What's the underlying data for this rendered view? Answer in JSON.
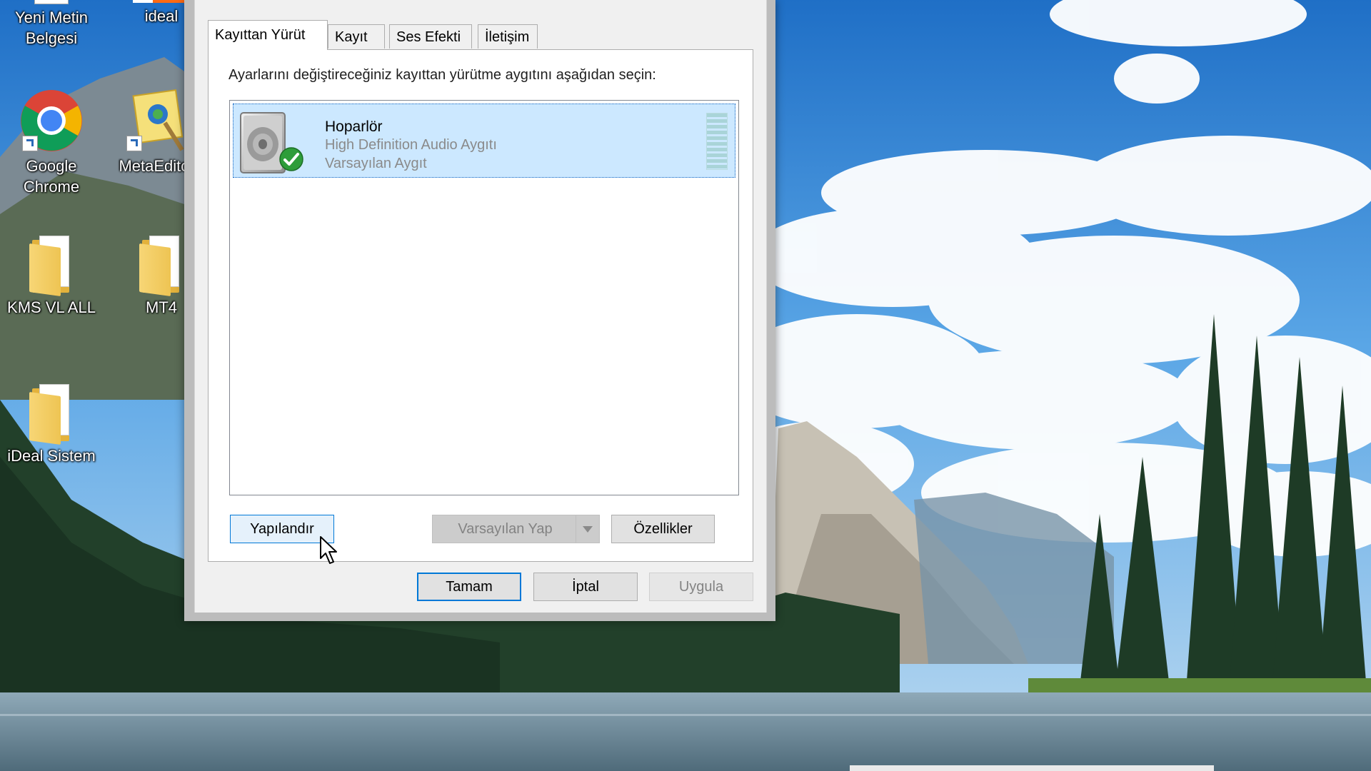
{
  "desktop": {
    "icons": [
      {
        "id": "yeni-metin",
        "label": "Yeni Metin Belgesi"
      },
      {
        "id": "ideal",
        "label": "ideal"
      },
      {
        "id": "google-chrome",
        "label": "Google Chrome"
      },
      {
        "id": "metaeditor",
        "label": "MetaEdito"
      },
      {
        "id": "kms",
        "label": "KMS VL ALL"
      },
      {
        "id": "mt4",
        "label": "MT4"
      },
      {
        "id": "ideal-sistem",
        "label": "iDeal Sistem"
      }
    ]
  },
  "dialog": {
    "tabs": [
      {
        "label": "Kayıttan Yürüt",
        "active": true
      },
      {
        "label": "Kayıt",
        "active": false
      },
      {
        "label": "Ses Efekti",
        "active": false
      },
      {
        "label": "İletişim",
        "active": false
      }
    ],
    "instruction": "Ayarlarını değiştireceğiniz kayıttan yürütme aygıtını aşağıdan seçin:",
    "devices": [
      {
        "name": "Hoparlör",
        "description": "High Definition Audio Aygıtı",
        "status": "Varsayılan Aygıt",
        "icon": "speaker-icon",
        "badge": "default-check-icon",
        "selected": true
      }
    ],
    "buttons": {
      "configure": "Yapılandır",
      "set_default": "Varsayılan Yap",
      "properties": "Özellikler",
      "ok": "Tamam",
      "cancel": "İptal",
      "apply": "Uygula"
    },
    "colors": {
      "accent": "#0078d7",
      "selection": "#cce8ff",
      "check_green": "#2e9d3a"
    }
  }
}
